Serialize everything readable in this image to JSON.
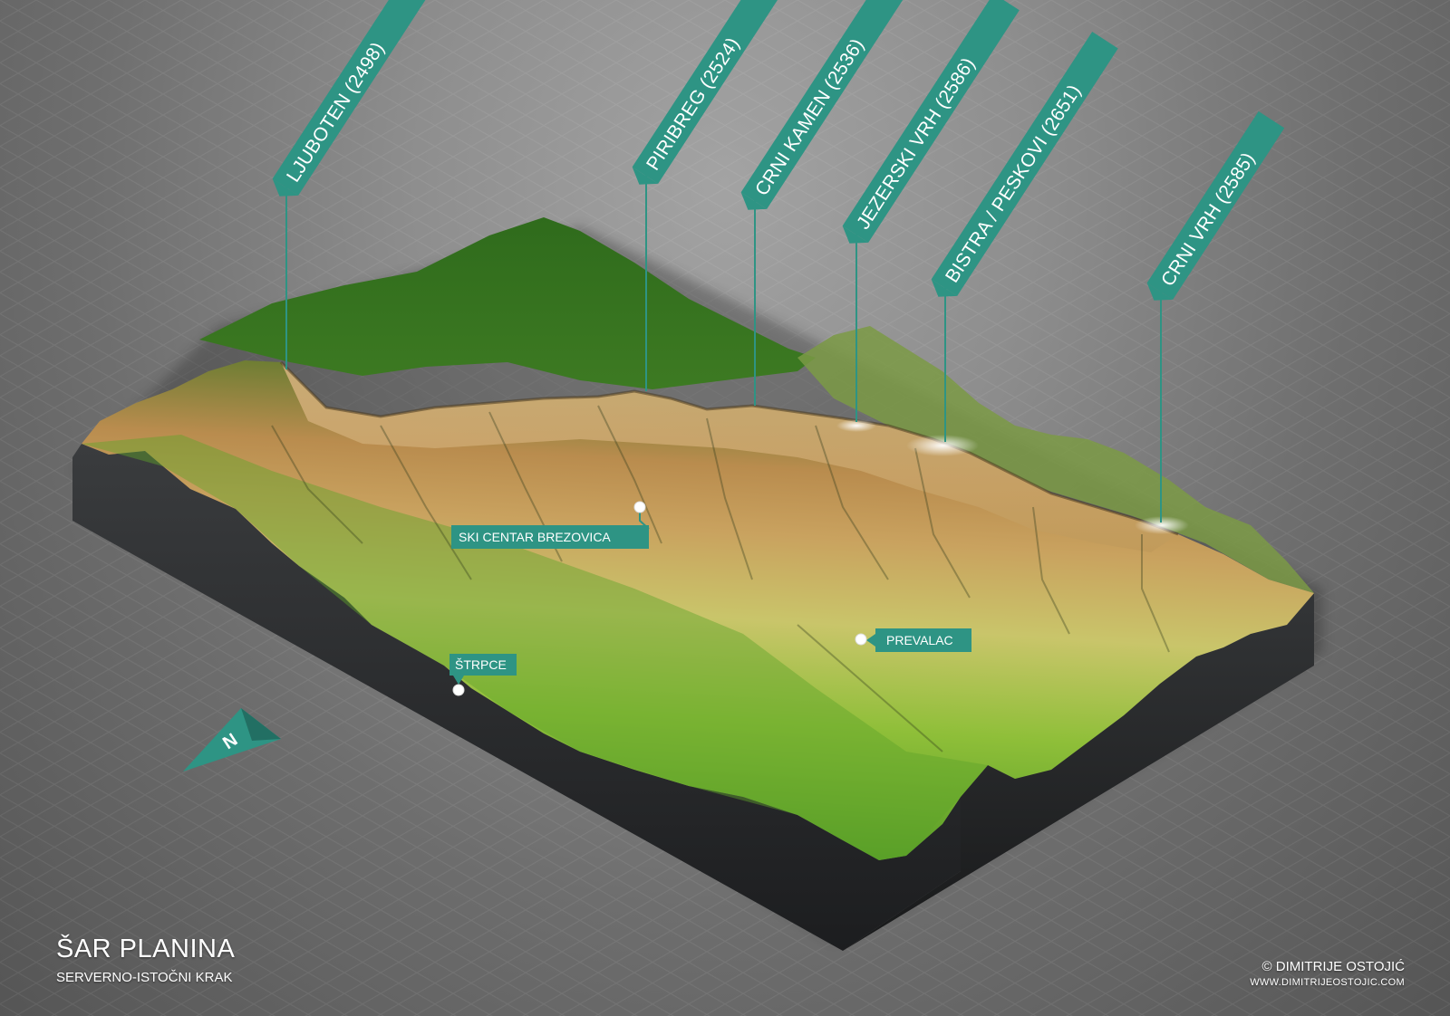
{
  "map": {
    "title": "ŠAR PLANINA",
    "subtitle": "SERVERNO-ISTOČNI KRAK",
    "credit": "© DIMITRIJE OSTOJIĆ",
    "website": "WWW.DIMITRIJEOSTOJIC.COM",
    "north_label": "N",
    "accent_color": "#2e9484",
    "peaks": [
      {
        "label": "LJUBOTEN (2498)"
      },
      {
        "label": "PIRIBREG (2524)"
      },
      {
        "label": "CRNI KAMEN (2536)"
      },
      {
        "label": "JEZERSKI VRH (2586)"
      },
      {
        "label": "BISTRA / PESKOVI (2651)"
      },
      {
        "label": "CRNI VRH (2585)"
      }
    ],
    "places": [
      {
        "label": "SKI CENTAR BREZOVICA"
      },
      {
        "label": "ŠTRPCE"
      },
      {
        "label": "PREVALAC"
      }
    ]
  }
}
